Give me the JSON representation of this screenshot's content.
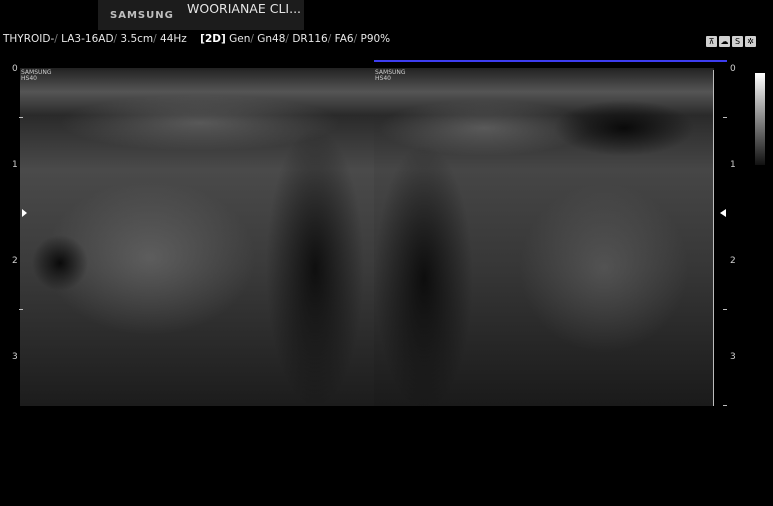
{
  "header": {
    "brand": "SAMSUNG",
    "clinic": "WOORIANAE CLI...",
    "preset": "THYROID-",
    "probe": "LA3-16AD",
    "depth": "3.5cm",
    "frame_rate": "44Hz",
    "mode": "[2D]",
    "params": [
      "Gen",
      "Gn48",
      "DR116",
      "FA6",
      "P90%"
    ]
  },
  "status_icons": [
    "probe-icon",
    "cloud-icon",
    "s-icon",
    "gear-icon"
  ],
  "status_icon_glyphs": [
    "⊼",
    "☁",
    "S",
    "✲"
  ],
  "images": {
    "left_probe_label": [
      "SAMSUNG",
      "HS40"
    ],
    "right_probe_label": [
      "SAMSUNG",
      "HS40"
    ]
  },
  "depth_scale": {
    "left": [
      "0",
      "1",
      "2",
      "3"
    ],
    "right": [
      "0",
      "1",
      "2",
      "3"
    ]
  },
  "colors": {
    "marker_line": "#3d3df0"
  }
}
